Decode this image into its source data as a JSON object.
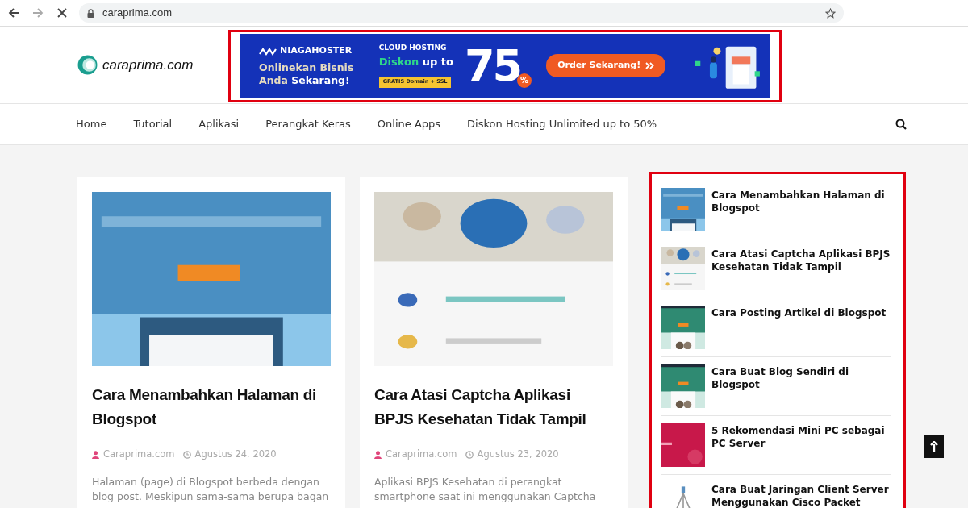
{
  "browser": {
    "url": "caraprima.com"
  },
  "header": {
    "logo_text": "caraprima.com",
    "ad": {
      "brand": "NIAGAHOSTER",
      "headline_1": "Onlinekan Bisnis",
      "headline_2a": "Anda",
      "headline_2b": "Sekarang!",
      "product": "CLOUD HOSTING",
      "discount_word": "Diskon",
      "discount_rest": "up to",
      "bonus": "GRATIS Domain + SSL",
      "number": "75",
      "percent": "%",
      "cta": "Order Sekarang!"
    }
  },
  "nav": {
    "items": [
      "Home",
      "Tutorial",
      "Aplikasi",
      "Perangkat Keras",
      "Online Apps",
      "Diskon Hosting Unlimited up to 50%"
    ]
  },
  "posts": [
    {
      "title": "Cara Menambahkan Halaman di Blogspot",
      "author": "Caraprima.com",
      "date": "Agustus 24, 2020",
      "excerpt": "Halaman (page) di Blogspot berbeda dengan blog post. Meskipun sama-sama berupa bagan"
    },
    {
      "title": "Cara Atasi Captcha Aplikasi BPJS Kesehatan Tidak Tampil",
      "author": "Caraprima.com",
      "date": "Agustus 23, 2020",
      "excerpt": "Aplikasi BPJS Kesehatan di perangkat smartphone saat ini menggunakan Captcha"
    }
  ],
  "sidebar": {
    "items": [
      {
        "title": "Cara Menambahkan Halaman di Blogspot"
      },
      {
        "title": "Cara Atasi Captcha Aplikasi BPJS Kesehatan Tidak Tampil"
      },
      {
        "title": "Cara Posting Artikel di Blogspot"
      },
      {
        "title": "Cara Buat Blog Sendiri di Blogspot"
      },
      {
        "title": "5 Rekomendasi Mini PC sebagai PC Server"
      },
      {
        "title": "Cara Buat Jaringan Client Server Menggunakan Cisco Packet"
      }
    ]
  }
}
